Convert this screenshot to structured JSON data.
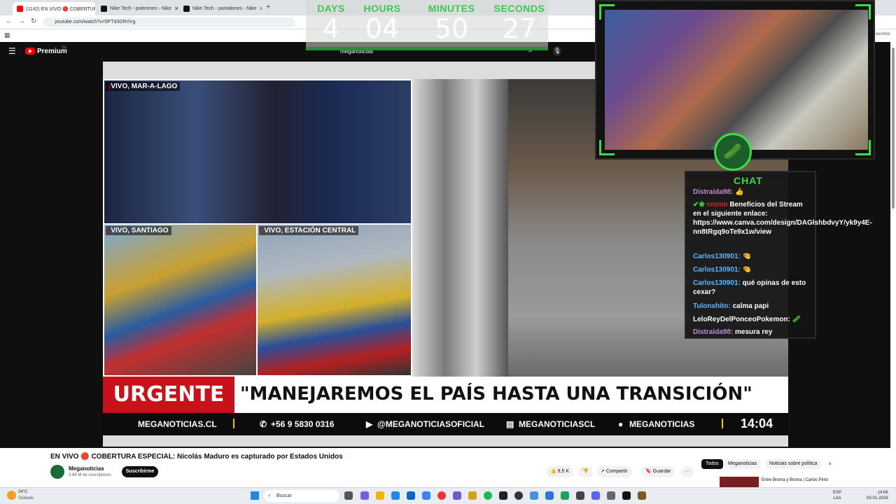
{
  "tabs": [
    {
      "title": "(1142) EN VIVO 🔴 COBERTURA",
      "active": true
    },
    {
      "title": "Nike Tech - polerones - Nike",
      "active": false
    },
    {
      "title": "Nike Tech - pantalones - Nike",
      "active": false
    }
  ],
  "address": {
    "url": "youtube.com/watch?v=5PTd3DRrIVg"
  },
  "bookmarks": {
    "right_label": "Favoritos"
  },
  "youtube": {
    "logo_text": "Premium",
    "country": "CL",
    "search_query": "meganoticias"
  },
  "countdown": {
    "days_label": "DAYS",
    "days": "4",
    "hours_label": "HOURS",
    "hours": "04",
    "minutes_label": "MINUTES",
    "minutes": "50",
    "seconds_label": "SECONDS",
    "seconds": "27"
  },
  "video": {
    "labels": {
      "top": "VIVO, MAR-A-LAGO",
      "bottom_left": "VIVO, SANTIAGO",
      "bottom_right": "VIVO, ESTACIÓN CENTRAL",
      "live_prefix": "¡"
    },
    "urgente": "URGENTE",
    "headline": "\"MANEJAREMOS EL PAÍS HASTA UNA TRANSICIÓN\"",
    "ticker": {
      "site": "MEGANOTICIAS.CL",
      "phone": "+56 9 5830 0316",
      "youtube": "@MEGANOTICIASOFICIAL",
      "twitch": "MEGANOTICIASCL",
      "spotify": "MEGANOTICIAS",
      "time": "14:04"
    }
  },
  "chat": {
    "title": "CHAT",
    "messages": [
      {
        "user": "Distraida98:",
        "text": "👍"
      },
      {
        "user": "",
        "text": "Beneficios del Stream en el siguiente enlace: https://www.canva.com/design/DAGlshbdvyY/yk9y4E-nn8tRgq9oTe9x1w/view"
      },
      {
        "user": "Carlos130901:",
        "text": "🤏"
      },
      {
        "user": "Carlos130901:",
        "text": "🤏"
      },
      {
        "user": "Carlos130901:",
        "text": "qué opinas de esto cexar?"
      },
      {
        "user": "Tulonxhito:",
        "text": "calma papi"
      },
      {
        "user": "LeloReyDelPonceoPokemon:",
        "text": "🥒"
      },
      {
        "user": "Distraida98:",
        "text": "mesura rey"
      }
    ]
  },
  "details": {
    "title": "EN VIVO 🔴 COBERTURA ESPECIAL: Nicolás Maduro es capturado por Estados Unidos",
    "channel": "Meganoticias",
    "subscribers": "3,68 M de suscriptores",
    "subscribe": "Suscribirme",
    "likes": "9,5 K",
    "share": "Compartir",
    "save": "Guardar",
    "more": "···"
  },
  "recommendations": {
    "chips": [
      "Todos",
      "Meganoticias",
      "Noticias sobre política"
    ],
    "first_title": "Entre Broma y Broma | Carlos Pinto"
  },
  "taskbar": {
    "weather_temp": "24°C",
    "weather_desc": "Soleado",
    "search": "Buscar",
    "lang_1": "ESP",
    "lang_2": "LAA",
    "time": "14:06",
    "date": "03-01-2026"
  }
}
